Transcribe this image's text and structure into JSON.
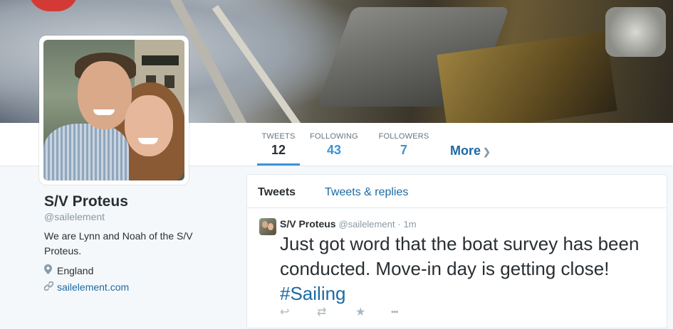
{
  "navbar": {
    "stats": [
      {
        "label": "TWEETS",
        "value": "12"
      },
      {
        "label": "FOLLOWING",
        "value": "43"
      },
      {
        "label": "FOLLOWERS",
        "value": "7"
      }
    ],
    "more_label": "More",
    "more_icon": "chevron-down-icon"
  },
  "profile": {
    "name": "S/V Proteus",
    "handle": "@sailelement",
    "bio": "We are Lynn and Noah of the S/V Proteus.",
    "location": "England",
    "location_icon": "map-pin-icon",
    "website": "sailelement.com",
    "website_icon": "link-icon"
  },
  "timeline": {
    "tabs": [
      "Tweets",
      "Tweets & replies"
    ],
    "tweet": {
      "name": "S/V Proteus",
      "handle": "@sailelement",
      "separator": "·",
      "time": "1m",
      "text": "Just got word that the boat survey has been conducted. Move-in day is getting close!",
      "hashtag": "#Sailing",
      "actions": [
        {
          "icon": "reply-icon",
          "glyph": "↩"
        },
        {
          "icon": "retweet-icon",
          "glyph": "⇄"
        },
        {
          "icon": "favorite-star-icon",
          "glyph": "★"
        },
        {
          "icon": "more-dots-icon",
          "glyph": "•••"
        }
      ]
    }
  },
  "colors": {
    "link": "#1b6aa5",
    "accent": "#3b94d9",
    "muted": "#8899a6",
    "text": "#292f33"
  }
}
